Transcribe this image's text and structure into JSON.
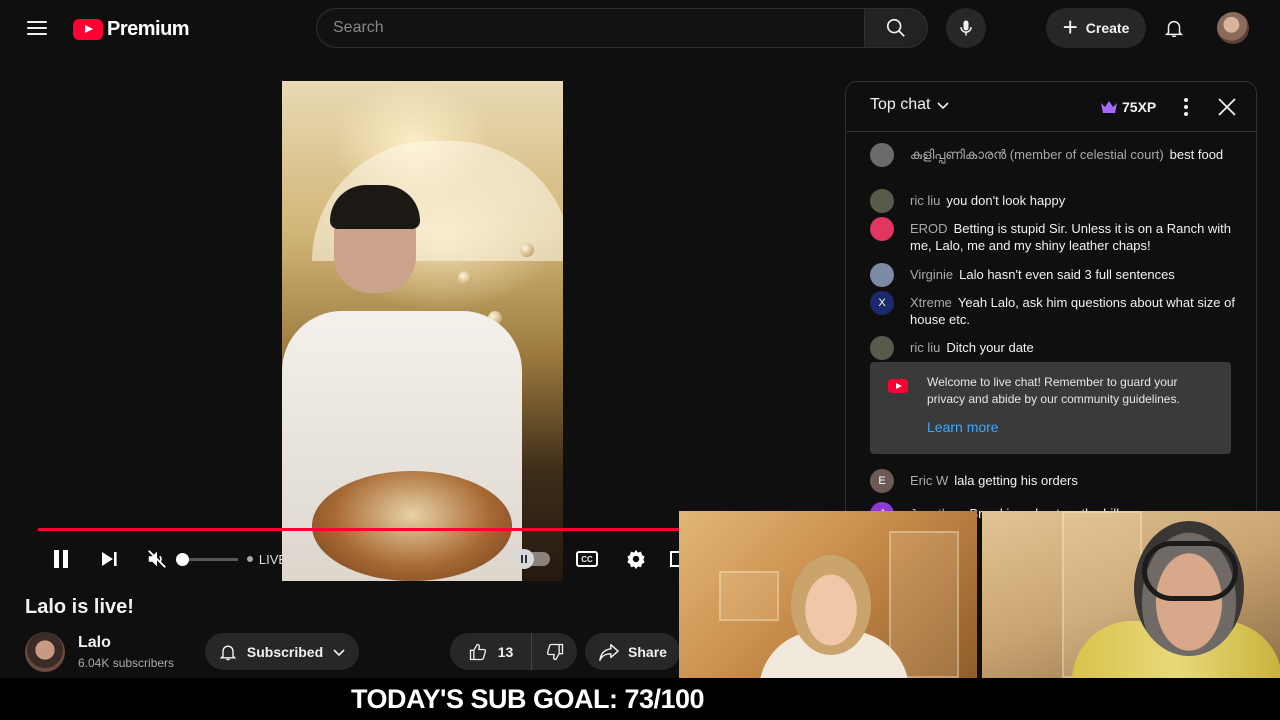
{
  "header": {
    "logo_text": "Premium",
    "search_placeholder": "Search",
    "create_label": "Create"
  },
  "player": {
    "live_label": "LIVE",
    "cc_label": "CC"
  },
  "video": {
    "title": "Lalo is live!",
    "channel_name": "Lalo",
    "subscribers": "6.04K subscribers",
    "subscribed_label": "Subscribed",
    "likes": "13",
    "share_label": "Share"
  },
  "chat": {
    "mode": "Top chat",
    "xp": "75XP",
    "messages": [
      {
        "author": "കുളിപ്പണികാരൻ (member of celestial court)",
        "text": "best food",
        "avatar_color": "#6b6b6b",
        "avatar_letter": ""
      },
      {
        "author": "ric liu",
        "text": "you don't look happy",
        "avatar_color": "#5a5a4a",
        "avatar_letter": ""
      },
      {
        "author": "EROD",
        "text": "Betting is stupid Sir. Unless it is on a Ranch with me, Lalo, me and my shiny leather chaps!",
        "avatar_color": "#e0365f",
        "avatar_letter": ""
      },
      {
        "author": "Virginie",
        "text": "Lalo hasn't even said 3 full sentences",
        "avatar_color": "#7c8aa6",
        "avatar_letter": ""
      },
      {
        "author": "Xtreme",
        "text": "Yeah Lalo, ask him questions about what size of house etc.",
        "avatar_color": "#1a2a6c",
        "avatar_letter": "X"
      },
      {
        "author": "ric liu",
        "text": "Ditch your date",
        "avatar_color": "#5a5a4a",
        "avatar_letter": ""
      },
      {
        "author": "Eric W",
        "text": "lala getting his orders",
        "avatar_color": "#6d5a55",
        "avatar_letter": "E"
      },
      {
        "author": "Jonathan",
        "text": "Bro skipped out on the bill",
        "avatar_color": "#8e3bd6",
        "avatar_letter": "J"
      }
    ],
    "welcome_text": "Welcome to live chat! Remember to guard your privacy and abide by our community guidelines.",
    "learn_more": "Learn more"
  },
  "overlay": {
    "sub_goal": "TODAY'S SUB GOAL: 73/100"
  },
  "colors": {
    "accent": "#ff0033",
    "link": "#3ea6ff",
    "xp_crown": "#a56bff"
  }
}
